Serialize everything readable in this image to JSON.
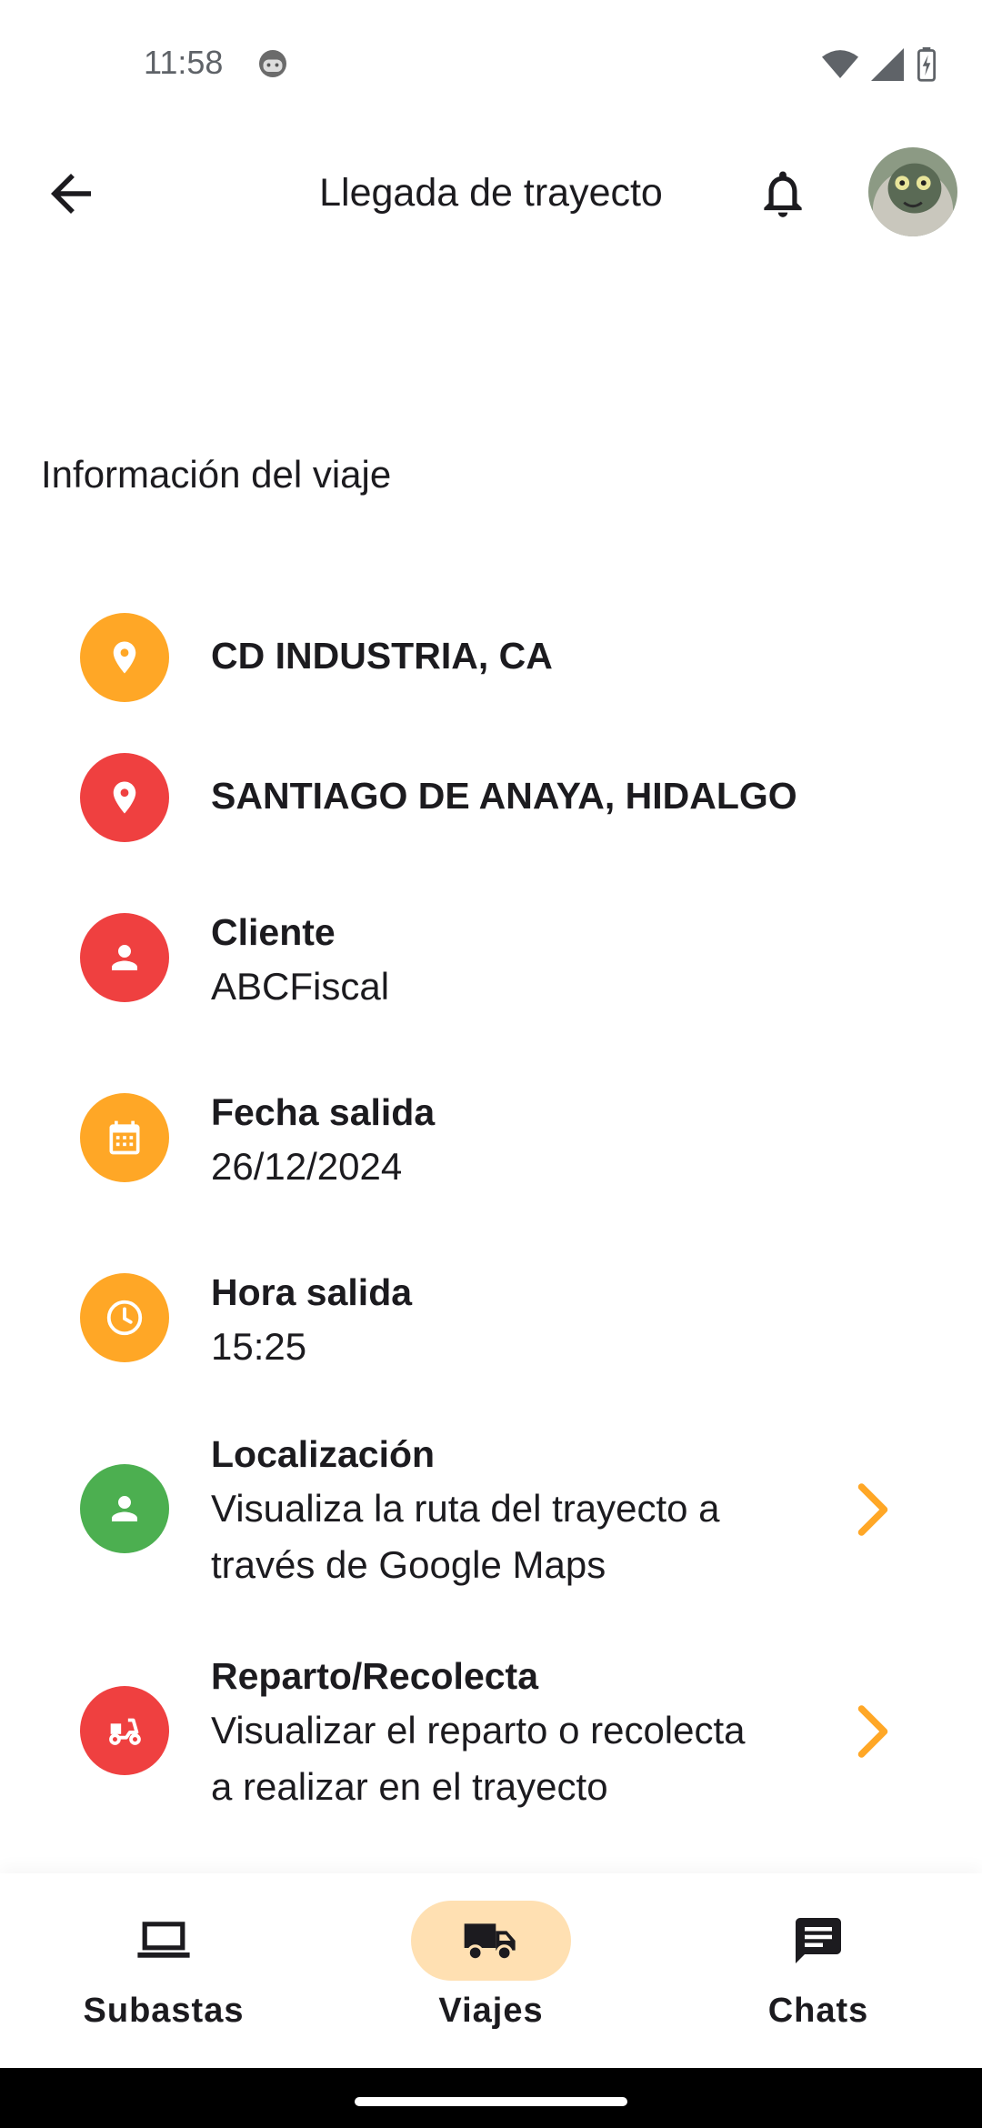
{
  "status": {
    "time": "11:58"
  },
  "app_bar": {
    "title": "Llegada de trayecto"
  },
  "section": {
    "title": "Información del viaje"
  },
  "colors": {
    "orange": "#FFA726",
    "red": "#EF4040",
    "green": "#4CAF50",
    "nav_active_bg": "#FFE0B2",
    "chevron": "#FFA726"
  },
  "items": [
    {
      "icon": "location-pin-icon",
      "title": "CD INDUSTRIA, CA"
    },
    {
      "icon": "location-pin-icon",
      "title": "SANTIAGO DE ANAYA, HIDALGO"
    },
    {
      "icon": "person-icon",
      "title": "Cliente",
      "value": "ABCFiscal"
    },
    {
      "icon": "calendar-icon",
      "title": "Fecha salida",
      "value": "26/12/2024"
    },
    {
      "icon": "clock-icon",
      "title": "Hora salida",
      "value": "15:25"
    },
    {
      "icon": "person-icon",
      "title": "Localización",
      "value_line1": "Visualiza la ruta del trayecto a",
      "value_line2": "través de Google Maps"
    },
    {
      "icon": "delivery-scooter-icon",
      "title": "Reparto/Recolecta",
      "value_line1": "Visualizar el reparto o recolecta",
      "value_line2": "a realizar en el trayecto"
    }
  ],
  "nav": [
    {
      "label": "Subastas",
      "icon": "laptop-icon",
      "active": false
    },
    {
      "label": "Viajes",
      "icon": "truck-icon",
      "active": true
    },
    {
      "label": "Chats",
      "icon": "chat-icon",
      "active": false
    }
  ]
}
